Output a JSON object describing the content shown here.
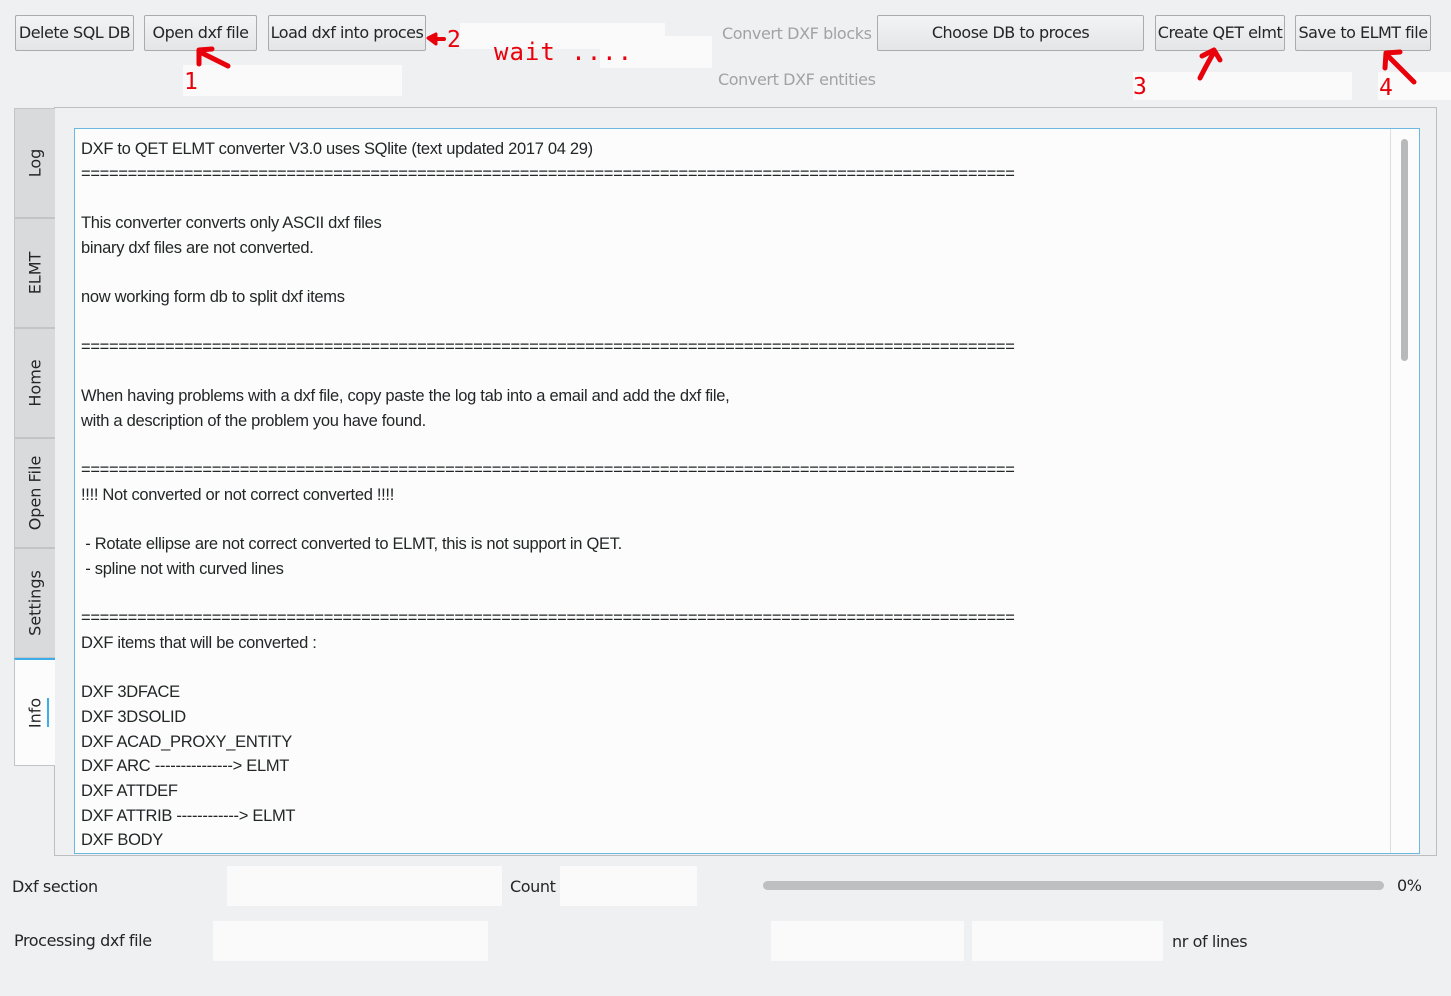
{
  "toolbar": {
    "delete_sql_db": "Delete SQL DB",
    "open_dxf_file": "Open dxf file",
    "load_dxf_into_proces": "Load dxf into proces",
    "convert_dxf_blocks": "Convert DXF blocks",
    "convert_dxf_entities": "Convert DXF entities",
    "choose_db_to_proces": "Choose DB to proces",
    "create_qet_elmt": "Create QET elmt",
    "save_to_elmt_file": "Save to ELMT file"
  },
  "annotations": {
    "step1": "1",
    "step2": "2",
    "step3": "3",
    "step4": "4",
    "wait": "wait ....",
    "color": "#e8000b"
  },
  "tabs": [
    {
      "label": "Log",
      "active": false
    },
    {
      "label": "ELMT",
      "active": false
    },
    {
      "label": "Home",
      "active": false
    },
    {
      "label": "Open File",
      "active": false
    },
    {
      "label": "Settings",
      "active": false
    },
    {
      "label": "Info",
      "active": true
    }
  ],
  "info_text": [
    "DXF to QET ELMT converter V3.0 uses SQlite (text updated 2017 04 29)",
    "====================================================================================================",
    "",
    "This converter converts only ASCII dxf files",
    "binary dxf files are not converted.",
    "",
    "now working form db to split dxf items",
    "",
    "====================================================================================================",
    "",
    "When having problems with a dxf file, copy paste the log tab into a email and add the dxf file,",
    "with a description of the problem you have found.",
    "",
    "====================================================================================================",
    "!!!! Not converted or not correct converted !!!!",
    "",
    " - Rotate ellipse are not correct converted to ELMT, this is not support in QET.",
    " - spline not with curved lines",
    "",
    "====================================================================================================",
    "DXF items that will be converted :",
    "",
    "DXF 3DFACE",
    "DXF 3DSOLID",
    "DXF ACAD_PROXY_ENTITY",
    "DXF ARC ---------------> ELMT",
    "DXF ATTDEF",
    "DXF ATTRIB ------------> ELMT",
    "DXF BODY"
  ],
  "status": {
    "dxf_section_label": "Dxf section",
    "dxf_section_value": "",
    "count_label": "Count",
    "count_value": "",
    "progress": 0,
    "progress_text": "0%",
    "processing_label": "Processing dxf file",
    "processing_value": "",
    "field_a_value": "",
    "field_b_value": "",
    "nr_of_lines_label": "nr of lines"
  },
  "colors": {
    "accent": "#3daee9",
    "background": "#eff0f1"
  }
}
